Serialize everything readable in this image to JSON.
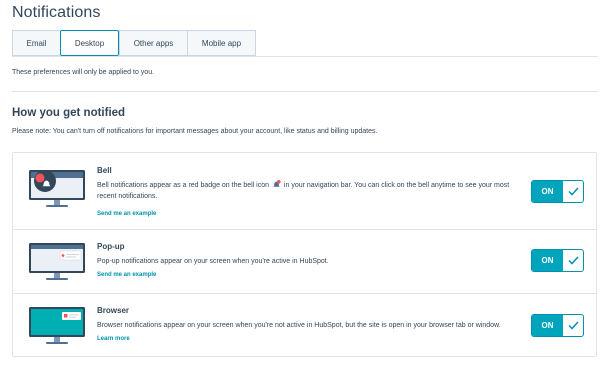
{
  "header": {
    "title": "Notifications"
  },
  "tabs": [
    {
      "label": "Email"
    },
    {
      "label": "Desktop"
    },
    {
      "label": "Other apps"
    },
    {
      "label": "Mobile app"
    }
  ],
  "preference_note": "These preferences will only be applied to you.",
  "section": {
    "heading": "How you get notified",
    "note": "Please note: You can't turn off notifications for important messages about your account, like status and billing updates."
  },
  "cards": [
    {
      "title": "Bell",
      "description_a": "Bell notifications appear as a red badge on the bell icon",
      "description_b": "in your navigation bar. You can click on the bell anytime to see your most recent notifications.",
      "link": "Send me an example",
      "toggle": "ON"
    },
    {
      "title": "Pop-up",
      "description": "Pop-up notifications appear on your screen when you're active in HubSpot.",
      "link": "Send me an example",
      "toggle": "ON"
    },
    {
      "title": "Browser",
      "description": "Browser notifications appear on your screen when you're not active in HubSpot, but the site is open in your browser tab or window.",
      "link": "Learn more",
      "toggle": "ON"
    }
  ],
  "colors": {
    "accent": "#00a4bd",
    "accent_border": "#0091ae",
    "text": "#33475b",
    "border": "#dfe3eb",
    "badge": "#f2545b"
  },
  "icons": [
    "bell-icon",
    "checkmark-icon"
  ]
}
